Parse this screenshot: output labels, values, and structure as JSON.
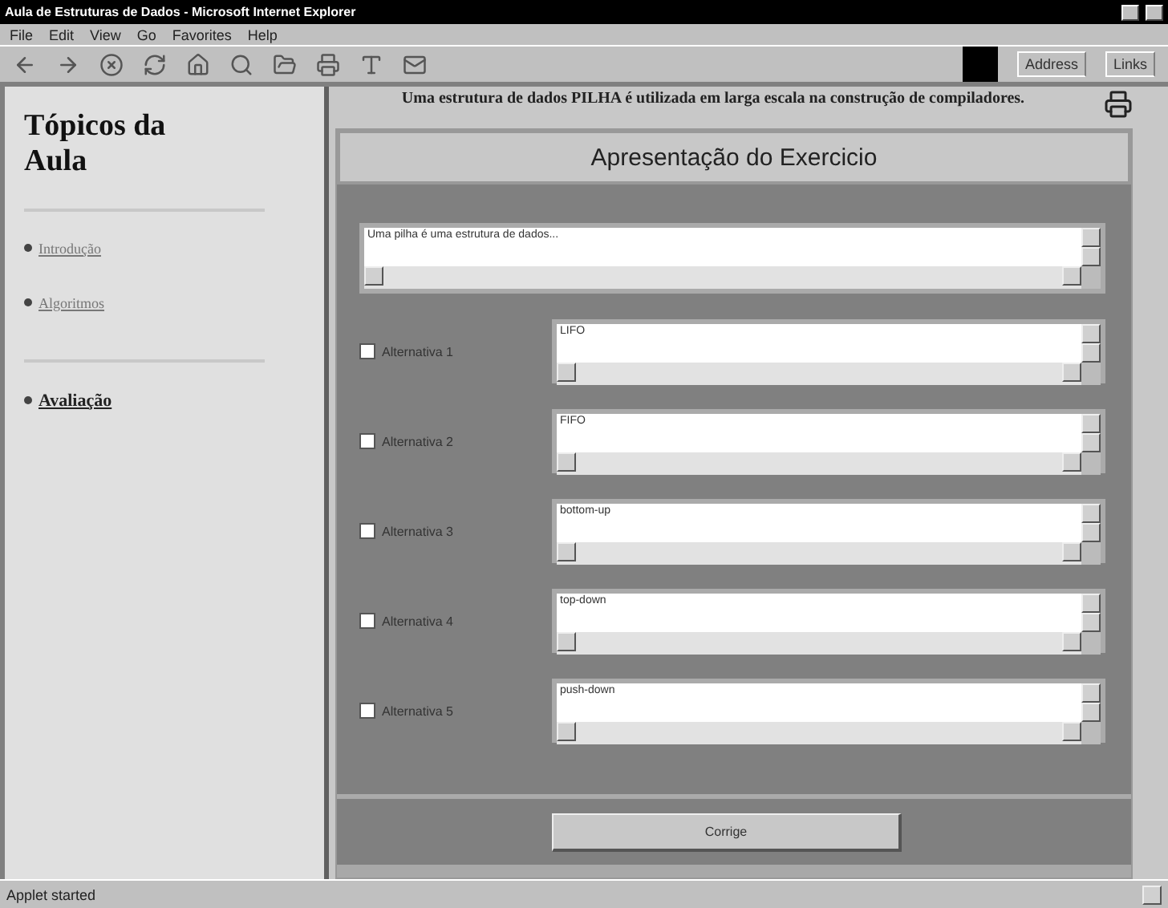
{
  "window": {
    "title": "Aula de Estruturas de Dados - Microsoft Internet Explorer"
  },
  "menu": [
    "File",
    "Edit",
    "View",
    "Go",
    "Favorites",
    "Help"
  ],
  "toolbar": {
    "address_label": "Address",
    "links_label": "Links"
  },
  "sidebar": {
    "title": "Tópicos da Aula",
    "items": [
      {
        "label": "Introdução",
        "selected": false
      },
      {
        "label": "Algoritmos",
        "selected": false
      },
      {
        "label": "Avaliação",
        "selected": true
      }
    ]
  },
  "question": "Uma estrutura de dados PILHA é utilizada em larga escala na construção de compiladores.",
  "exercise": {
    "title": "Apresentação do Exercicio",
    "statement": "Uma pilha é uma estrutura de dados...",
    "alternatives": [
      {
        "label": "Alternativa 1",
        "value": "LIFO",
        "checked": false
      },
      {
        "label": "Alternativa 2",
        "value": "FIFO",
        "checked": false
      },
      {
        "label": "Alternativa 3",
        "value": "bottom-up",
        "checked": false
      },
      {
        "label": "Alternativa 4",
        "value": "top-down",
        "checked": false
      },
      {
        "label": "Alternativa 5",
        "value": "push-down",
        "checked": false
      }
    ],
    "button": "Corrige"
  },
  "status_bar": "Applet started"
}
